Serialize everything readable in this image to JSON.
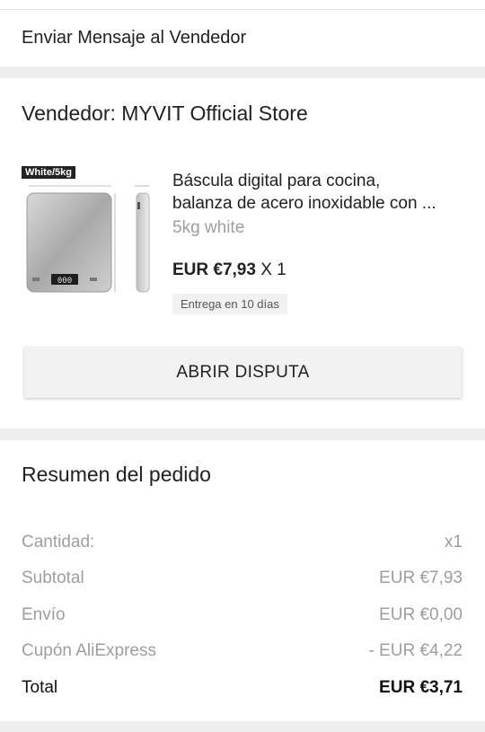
{
  "message_seller": {
    "label": "Enviar Mensaje al Vendedor"
  },
  "seller": {
    "heading": "Vendedor: MYVIT Official Store",
    "product": {
      "badge": "White/5kg",
      "title_line1": "Báscula digital para cocina,",
      "title_line2": "balanza de acero inoxidable con ...",
      "variant": "5kg white",
      "price": "EUR €7,93",
      "quantity": "X 1",
      "delivery": "Entrega en 10 días",
      "display_reading": "000"
    },
    "dispute_button": "ABRIR DISPUTA"
  },
  "summary": {
    "title": "Resumen del pedido",
    "rows": [
      {
        "label": "Cantidad:",
        "value": "x1"
      },
      {
        "label": "Subtotal",
        "value": "EUR €7,93"
      },
      {
        "label": "Envío",
        "value": "EUR €0,00"
      },
      {
        "label": "Cupón AliExpress",
        "value": "- EUR €4,22"
      },
      {
        "label": "Total",
        "value": "EUR €3,71"
      }
    ]
  }
}
